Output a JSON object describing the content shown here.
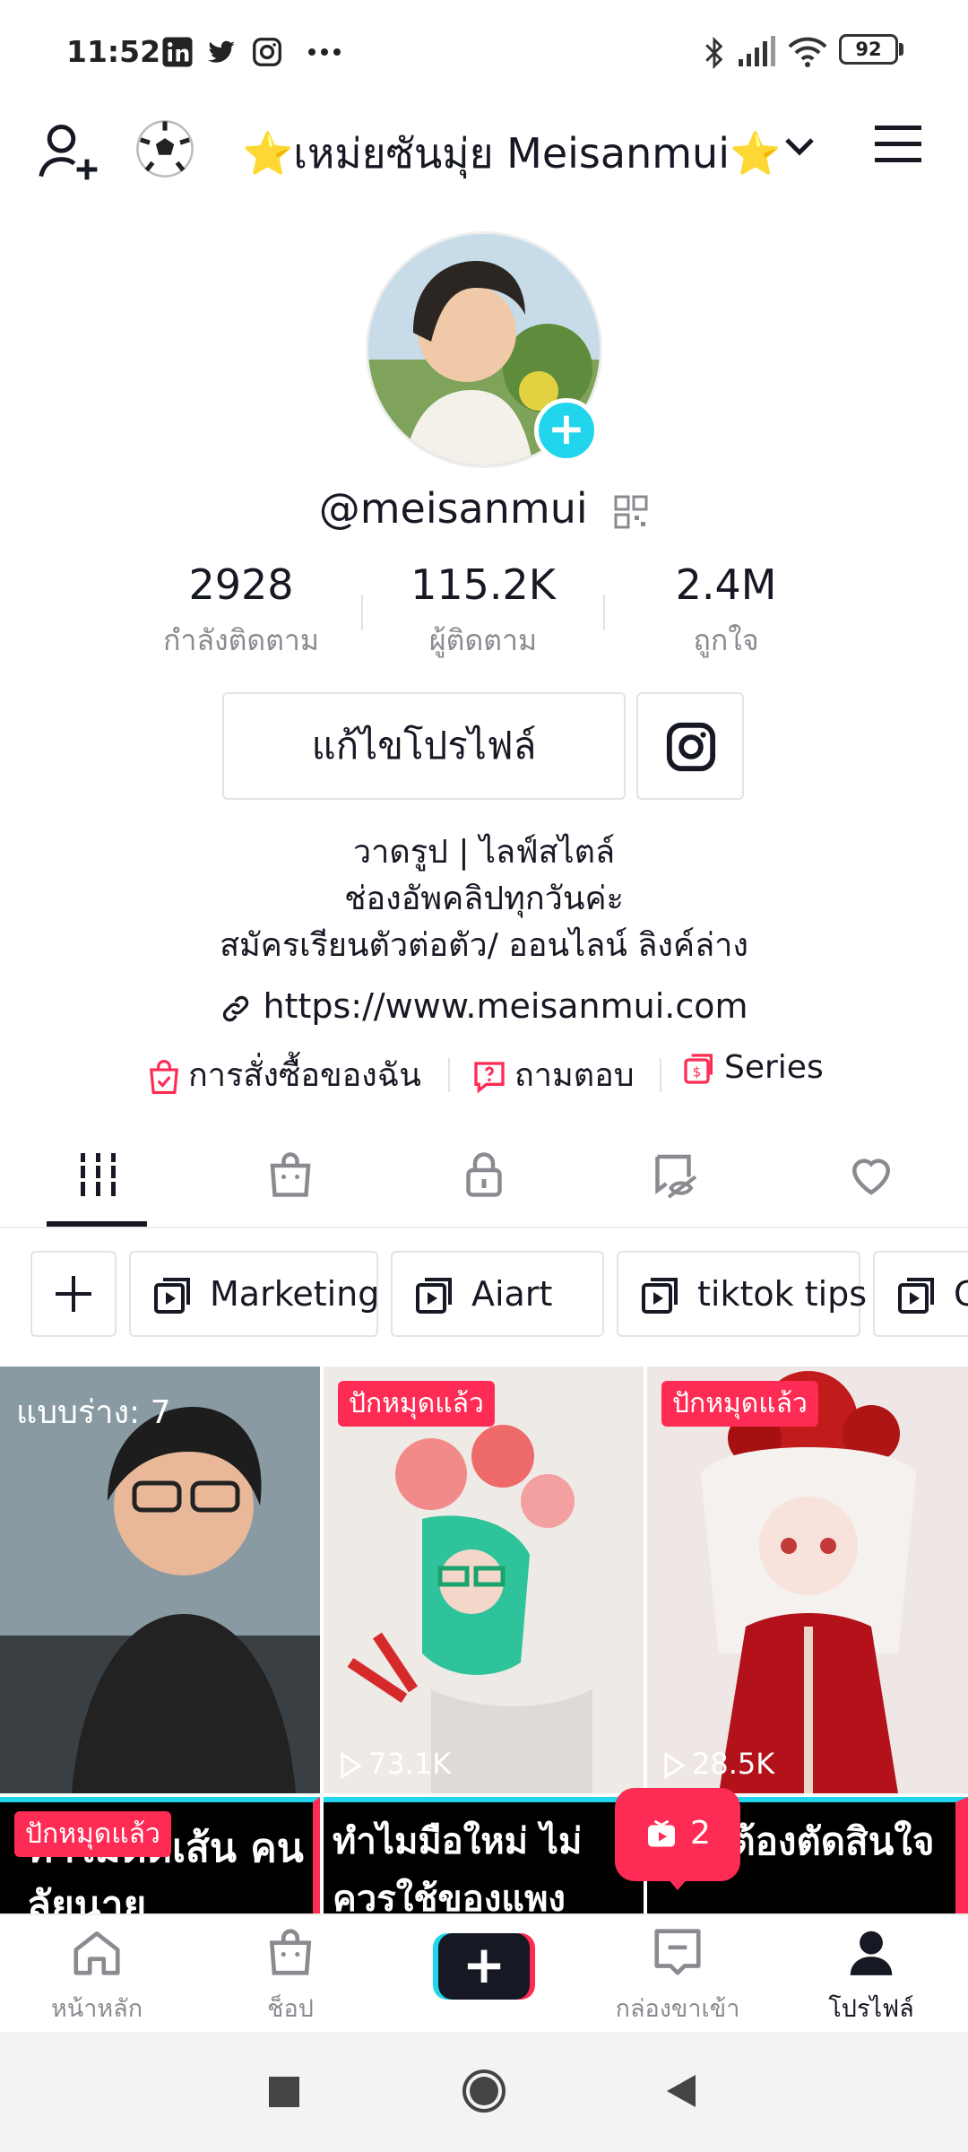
{
  "status_bar": {
    "time": "11:52",
    "battery": "92",
    "left_icons": [
      "linkedin-icon",
      "twitter-icon",
      "instagram-icon",
      "more-dots-icon"
    ],
    "right_icons": [
      "bluetooth-icon",
      "signal-icon",
      "wifi-icon",
      "battery-icon"
    ]
  },
  "header": {
    "star_left": "⭐",
    "title": "เหม่ยซันมุ่ย Meisanmui",
    "star_right": "⭐"
  },
  "profile": {
    "username": "@meisanmui",
    "stats": [
      {
        "value": "2928",
        "label": "กำลังติดตาม"
      },
      {
        "value": "115.2K",
        "label": "ผู้ติดตาม"
      },
      {
        "value": "2.4M",
        "label": "ถูกใจ"
      }
    ],
    "edit_button": "แก้ไขโปรไฟล์",
    "bio_lines": [
      "วาดรูป | ไลฟ์สไตล์",
      "ช่องอัพคลิปทุกวันค่ะ",
      "สมัครเรียนตัวต่อตัว/ ออนไลน์ ลิงค์ล่าง"
    ],
    "link": "https://www.meisanmui.com",
    "extras": [
      "การสั่งซื้อของฉัน",
      "ถามตอบ",
      "Series"
    ]
  },
  "playlists": [
    "Marketing",
    "Aiart",
    "tiktok tips",
    "C"
  ],
  "videos": [
    {
      "draft_label": "แบบร่าง: 7"
    },
    {
      "badge": "ปักหมุดแล้ว",
      "views": "73.1K"
    },
    {
      "badge": "ปักหมุดแล้ว",
      "views": "28.5K"
    },
    {
      "badge": "ปักหมุดแล้ว",
      "caption": "ทำไมติดเส้น คนลัยนาย"
    },
    {
      "caption": "ทำไมมือใหม่ ไม่ควรใช้ของแพง"
    },
    {
      "caption": "ไม่ ต้องตัดสินใจ"
    }
  ],
  "live_fab": {
    "count": "2"
  },
  "bottom_nav": [
    {
      "label": "หน้าหลัก",
      "icon": "home-icon"
    },
    {
      "label": "ช็อป",
      "icon": "shop-bag-icon"
    },
    {
      "label": "",
      "icon": "create-plus-icon"
    },
    {
      "label": "กล่องขาเข้า",
      "icon": "inbox-icon"
    },
    {
      "label": "โปรไฟล์",
      "icon": "profile-icon"
    }
  ],
  "colors": {
    "accent": "#fe2c55",
    "cyan": "#20d5ec",
    "text": "#161823",
    "muted": "#8a8b91"
  }
}
